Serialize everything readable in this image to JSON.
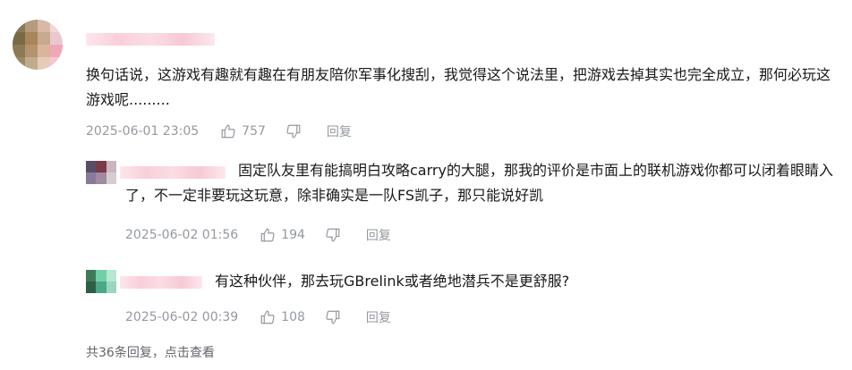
{
  "main_comment": {
    "text": "换句话说，这游戏有趣就有趣在有朋友陪你军事化搜刮，我觉得这个说法里，把游戏去掉其实也完全成立，那何必玩这游戏呢.........",
    "time": "2025-06-01 23:05",
    "likes": "757",
    "reply_label": "回复",
    "like_icon": "thumbs-up-icon",
    "dislike_icon": "thumbs-down-icon"
  },
  "replies": [
    {
      "text": "固定队友里有能搞明白攻略carry的大腿，那我的评价是市面上的联机游戏你都可以闭着眼睛入了，不一定非要玩这玩意，除非确实是一队FS凯子，那只能说好凯",
      "time": "2025-06-02 01:56",
      "likes": "194",
      "reply_label": "回复"
    },
    {
      "text": "有这种伙伴，那去玩GBrelink或者绝地潜兵不是更舒服?",
      "time": "2025-06-02 00:39",
      "likes": "108",
      "reply_label": "回复"
    }
  ],
  "more_replies": "共36条回复，点击查看",
  "colors": {
    "text": "#18191c",
    "meta": "#9499a0",
    "more": "#61666d"
  }
}
